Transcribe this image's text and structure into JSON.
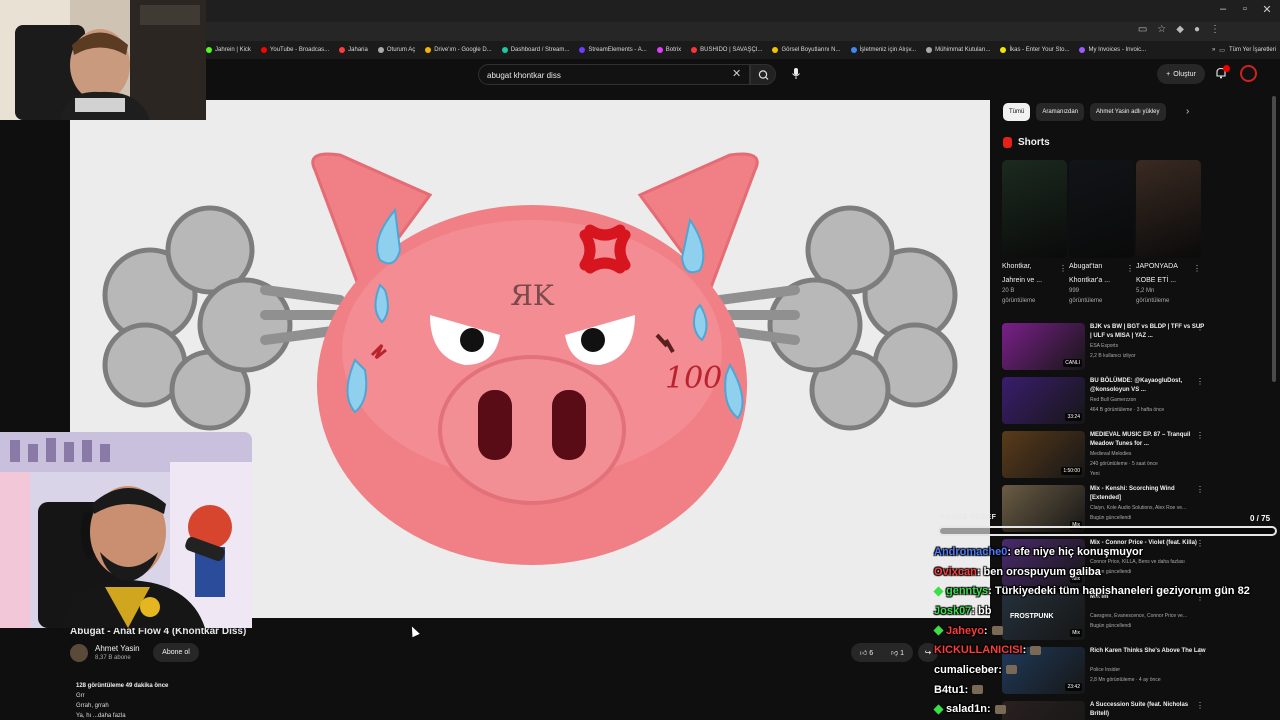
{
  "browser": {
    "bookmarks": [
      {
        "label": "Jahrein | Kick",
        "color": "#53fc18"
      },
      {
        "label": "YouTube - Broadcas...",
        "color": "#ff0000"
      },
      {
        "label": "Jaharia",
        "color": "#ff3b3b"
      },
      {
        "label": "Oturum Aç",
        "color": "#aaaaaa"
      },
      {
        "label": "Drive'ım - Google D...",
        "color": "#f4b400"
      },
      {
        "label": "Dashboard / Stream...",
        "color": "#1ec8a0"
      },
      {
        "label": "StreamElements - A...",
        "color": "#6c3cff"
      },
      {
        "label": "Botrix",
        "color": "#e23cff"
      },
      {
        "label": "BUSHIDO | SAVAŞÇI...",
        "color": "#ff3333"
      },
      {
        "label": "Görsel Boyutlarını N...",
        "color": "#f2c200"
      },
      {
        "label": "İşletmeniz için Alışv...",
        "color": "#4285f4"
      },
      {
        "label": "Mühimmat Kutuları...",
        "color": "#aaaaaa"
      },
      {
        "label": "İkas - Enter Your Sto...",
        "color": "#f2e600"
      },
      {
        "label": "My Invoices - Invoic...",
        "color": "#9b59ff"
      }
    ],
    "bookmarks_more": "»",
    "all_bookmarks": "Tüm Yer İşaretleri"
  },
  "header": {
    "search_value": "abugat khontkar diss",
    "create_label": "Oluştur",
    "clear_glyph": "✕",
    "create_glyph": "+"
  },
  "video": {
    "title": "Abugat - Anat Flow 4 (Khontkar Diss)",
    "channel": "Ahmet Yasin",
    "subscribers": "8,37 B abone",
    "subscribe_label": "Abone ol",
    "likes": "6",
    "dislikes": "1",
    "views_time": "128 görüntüleme  49 dakika önce",
    "desc_lines": [
      "Grr",
      "Grrah, grrah",
      "Ya, hı ...daha fazla"
    ],
    "emoji_text": "ЯK",
    "emoji_score": "100"
  },
  "sidebar": {
    "chips": [
      "Tümü",
      "Aramanızdan",
      "Ahmet Yasin adlı yükley"
    ],
    "chip_next": "›",
    "shorts_title": "Shorts",
    "shorts": [
      {
        "title1": "Khontkar,",
        "title2": "Jahrein ve ...",
        "views1": "20 B",
        "views2": "görüntüleme",
        "thumb_color": "#1b2a1f"
      },
      {
        "title1": "Abugat'tan",
        "title2": "Khontkar'a ...",
        "views1": "999",
        "views2": "görüntüleme",
        "thumb_color": "#111418"
      },
      {
        "title1": "JAPONYADA",
        "title2": "KOBE ETİ ...",
        "views1": "5,2 Mn",
        "views2": "görüntüleme",
        "thumb_color": "#3a2a22"
      }
    ],
    "recommendations": [
      {
        "title": "BJK vs BW | BGT vs BLDP | TFF vs SUP | ULF vs MISA | YAZ ...",
        "channel": "ESA Esports",
        "views": "2,2 B kullanıcı izliyor",
        "duration": "CANLI",
        "thumb_color": "#7a1f8a"
      },
      {
        "title": "BU BÖLÜMDE: @KayaogluDost, @konsoloyun VS ...",
        "channel": "Red Bull Gamerzzon",
        "views": "464 B görüntüleme · 3 hafta önce",
        "duration": "33:24",
        "thumb_color": "#3a1d6e"
      },
      {
        "title": "MEDIEVAL MUSIC EP. 87 – Tranquil Meadow Tunes for ...",
        "channel": "Medieval Melodies",
        "views": "240 görüntüleme · 5 saat önce",
        "extra": "Yeni",
        "duration": "1:50:00",
        "thumb_color": "#5a3b1a"
      },
      {
        "title": "Mix - Kenshi: Scorching Wind [Extended]",
        "channel": "Claiyn, Kole Audio Solutions, Alex Roe ve...",
        "views": "Bugün güncellendi",
        "duration": "Mix",
        "thumb_color": "#6b5c44"
      },
      {
        "title": "Mix - Connor Price - Violet (feat. Killa) [Official Audio]",
        "channel": "Connor Price, KILLA, Bens ve daha fazlası",
        "views": "Bugün güncellendi",
        "duration": "Mix",
        "thumb_color": "#4b2a6e"
      },
      {
        "title": "Mix'im",
        "channel": "Caesgrex, Evanescence, Connor Price ve...",
        "views": "Bugün güncellendi",
        "duration": "Mix",
        "thumb_color": "#24303a",
        "thumb_text": "FROSTPUNK"
      },
      {
        "title": "Rich Karen Thinks She's Above The Law",
        "channel": "Police Insider",
        "views": "2,8 Mn görüntüleme · 4 ay önce",
        "duration": "23:42",
        "thumb_color": "#1f3a5a"
      },
      {
        "title": "A Succession Suite (feat. Nicholas Britell)",
        "channel": "",
        "views": "",
        "duration": "",
        "thumb_color": "#2a2020"
      }
    ]
  },
  "overlay": {
    "goal_label": "ABONE HEDEF",
    "goal_count": "0 / 75",
    "goal_progress": 0.0,
    "chat": [
      {
        "user": "Andromache0",
        "message": ": efe niye hiç konuşmuyor",
        "color": "#4f7cff",
        "badge": ""
      },
      {
        "user": "Ovixcan",
        "message": ": ben orospuyum galiba",
        "color": "#ff3b3b",
        "badge": ""
      },
      {
        "user": "genntys",
        "message": ": Türkiyedeki tüm hapishaneleri geziyorum gün 82",
        "color": "#3adf4a",
        "badge": "#3adf4a"
      },
      {
        "user": "Josk07",
        "message": ": bb",
        "color": "#3adf4a",
        "badge": ""
      },
      {
        "user": "Jaheyo",
        "message": ":",
        "color": "#ff3b3b",
        "badge": "#3adf4a"
      },
      {
        "user": "KICKULLANICISI",
        "message": ":",
        "color": "#ff3b3b",
        "badge": ""
      },
      {
        "user": "cumaliceber",
        "message": ":",
        "color": "#ffffff",
        "badge": ""
      },
      {
        "user": "B4tu1",
        "message": ":",
        "color": "#ffffff",
        "badge": ""
      },
      {
        "user": "salad1n",
        "message": ":",
        "color": "#ffffff",
        "badge": "#3adf4a"
      }
    ]
  },
  "colors": {
    "pig_pink": "#f07f86",
    "yt_red": "#ff0000",
    "background": "#0f0f0f"
  }
}
